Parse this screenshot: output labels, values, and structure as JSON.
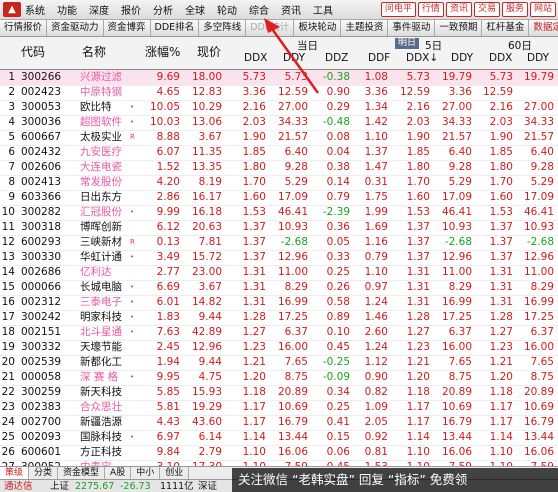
{
  "menu": {
    "items": [
      "系统",
      "功能",
      "深度",
      "报价",
      "分析",
      "全球",
      "轮动",
      "综合",
      "资讯",
      "工具"
    ],
    "right_buttons": [
      "问电平",
      "行情",
      "资讯",
      "交易",
      "服务",
      "网站"
    ]
  },
  "tabs": [
    "行情报价",
    "资金驱动力",
    "资金博弈",
    "DDE排名",
    "多空阵线",
    "DDF统计",
    "板块轮动",
    "主题投资",
    "事件驱动",
    "一致预期",
    "杠杆基金",
    "数据定制"
  ],
  "header": {
    "col_no": "",
    "col_code": "代码",
    "col_name": "名称",
    "col_change": "涨幅%",
    "col_price": "现价",
    "group_today": "当日",
    "group_5d": "5日",
    "group_60d": "60日",
    "tag_today": "明日",
    "sub": [
      "DDX",
      "DDY",
      "DDZ",
      "DDF",
      "DDX↓",
      "DDY",
      "DDX",
      "DDY"
    ]
  },
  "rows": [
    {
      "no": "1",
      "code": "300266",
      "name": "兴源过滤",
      "f": "",
      "chg": "9.69",
      "px": "18.00",
      "v": [
        "5.73",
        "5.73",
        "-0.38",
        "1.08",
        "5.73",
        "19.79",
        "5.73",
        "19.79"
      ]
    },
    {
      "no": "2",
      "code": "002423",
      "name": "中原特钢",
      "f": "",
      "chg": "4.65",
      "px": "12.83",
      "v": [
        "3.36",
        "12.59",
        "0.90",
        "3.36",
        "12.59",
        "3.36",
        "12.59",
        ""
      ]
    },
    {
      "no": "3",
      "code": "300053",
      "name": "欧比特",
      "f": "•",
      "chg": "10.05",
      "px": "10.29",
      "v": [
        "2.16",
        "27.00",
        "0.29",
        "1.34",
        "2.16",
        "27.00",
        "2.16",
        "27.00"
      ]
    },
    {
      "no": "4",
      "code": "300036",
      "name": "超图软件",
      "f": "•",
      "chg": "10.03",
      "px": "13.06",
      "v": [
        "2.03",
        "34.33",
        "-0.48",
        "1.42",
        "2.03",
        "34.33",
        "2.03",
        "34.33"
      ]
    },
    {
      "no": "5",
      "code": "600667",
      "name": "太极实业",
      "f": "R",
      "chg": "8.88",
      "px": "3.67",
      "v": [
        "1.90",
        "21.57",
        "0.08",
        "1.10",
        "1.90",
        "21.57",
        "1.90",
        "21.57"
      ]
    },
    {
      "no": "6",
      "code": "002432",
      "name": "九安医疗",
      "f": "",
      "chg": "6.07",
      "px": "11.35",
      "v": [
        "1.85",
        "6.40",
        "0.04",
        "1.37",
        "1.85",
        "6.40",
        "1.85",
        "6.40"
      ]
    },
    {
      "no": "7",
      "code": "002606",
      "name": "大连电瓷",
      "f": "",
      "chg": "1.52",
      "px": "13.35",
      "v": [
        "1.80",
        "9.28",
        "0.38",
        "1.47",
        "1.80",
        "9.28",
        "1.80",
        "9.28"
      ]
    },
    {
      "no": "8",
      "code": "002413",
      "name": "常发股份",
      "f": "",
      "chg": "4.20",
      "px": "8.19",
      "v": [
        "1.70",
        "5.29",
        "0.14",
        "0.31",
        "1.70",
        "5.29",
        "1.70",
        "5.29"
      ]
    },
    {
      "no": "9",
      "code": "603366",
      "name": "日出东方",
      "f": "",
      "chg": "2.86",
      "px": "16.17",
      "v": [
        "1.60",
        "17.09",
        "0.79",
        "1.75",
        "1.60",
        "17.09",
        "1.60",
        "17.09"
      ]
    },
    {
      "no": "10",
      "code": "300282",
      "name": "汇冠股份",
      "f": "•",
      "chg": "9.99",
      "px": "16.18",
      "v": [
        "1.53",
        "46.41",
        "-2.39",
        "1.99",
        "1.53",
        "46.41",
        "1.53",
        "46.41"
      ]
    },
    {
      "no": "11",
      "code": "300318",
      "name": "博晖创新",
      "f": "",
      "chg": "6.12",
      "px": "20.63",
      "v": [
        "1.37",
        "10.93",
        "0.36",
        "1.69",
        "1.37",
        "10.93",
        "1.37",
        "10.93"
      ]
    },
    {
      "no": "12",
      "code": "600293",
      "name": "三峡新材",
      "f": "R",
      "chg": "0.13",
      "px": "7.81",
      "v": [
        "1.37",
        "-2.68",
        "0.05",
        "1.16",
        "1.37",
        "-2.68",
        "1.37",
        "-2.68"
      ]
    },
    {
      "no": "13",
      "code": "300330",
      "name": "华虹计通",
      "f": "•",
      "chg": "3.49",
      "px": "15.72",
      "v": [
        "1.37",
        "12.96",
        "0.33",
        "0.79",
        "1.37",
        "12.96",
        "1.37",
        "12.96"
      ]
    },
    {
      "no": "14",
      "code": "002686",
      "name": "亿利达",
      "f": "",
      "chg": "2.77",
      "px": "23.00",
      "v": [
        "1.31",
        "11.00",
        "0.25",
        "1.10",
        "1.31",
        "11.00",
        "1.31",
        "11.00"
      ]
    },
    {
      "no": "15",
      "code": "000066",
      "name": "长城电脑",
      "f": "•",
      "chg": "6.69",
      "px": "3.67",
      "v": [
        "1.31",
        "8.29",
        "0.26",
        "0.97",
        "1.31",
        "8.29",
        "1.31",
        "8.29"
      ]
    },
    {
      "no": "16",
      "code": "002312",
      "name": "三泰电子",
      "f": "•",
      "chg": "6.01",
      "px": "14.82",
      "v": [
        "1.31",
        "16.99",
        "0.58",
        "1.24",
        "1.31",
        "16.99",
        "1.31",
        "16.99"
      ]
    },
    {
      "no": "17",
      "code": "300242",
      "name": "明家科技",
      "f": "•",
      "chg": "1.83",
      "px": "9.44",
      "v": [
        "1.28",
        "17.25",
        "0.89",
        "1.46",
        "1.28",
        "17.25",
        "1.28",
        "17.25"
      ]
    },
    {
      "no": "18",
      "code": "002151",
      "name": "北斗星通",
      "f": "•",
      "chg": "7.63",
      "px": "42.89",
      "v": [
        "1.27",
        "6.37",
        "0.10",
        "2.60",
        "1.27",
        "6.37",
        "1.27",
        "6.37"
      ]
    },
    {
      "no": "19",
      "code": "300332",
      "name": "天壕节能",
      "f": "",
      "chg": "2.45",
      "px": "12.96",
      "v": [
        "1.23",
        "16.00",
        "0.45",
        "1.24",
        "1.23",
        "16.00",
        "1.23",
        "16.00"
      ]
    },
    {
      "no": "20",
      "code": "002539",
      "name": "新都化工",
      "f": "",
      "chg": "1.94",
      "px": "9.44",
      "v": [
        "1.21",
        "7.65",
        "-0.25",
        "1.12",
        "1.21",
        "7.65",
        "1.21",
        "7.65"
      ]
    },
    {
      "no": "21",
      "code": "000058",
      "name": "深 赛 格",
      "f": "•",
      "chg": "9.95",
      "px": "4.75",
      "v": [
        "1.20",
        "8.75",
        "-0.09",
        "0.90",
        "1.20",
        "8.75",
        "1.20",
        "8.75"
      ]
    },
    {
      "no": "22",
      "code": "300259",
      "name": "新天科技",
      "f": "",
      "chg": "5.85",
      "px": "15.93",
      "v": [
        "1.18",
        "20.89",
        "0.34",
        "0.82",
        "1.18",
        "20.89",
        "1.18",
        "20.89"
      ]
    },
    {
      "no": "23",
      "code": "002383",
      "name": "合众思壮",
      "f": "",
      "chg": "5.81",
      "px": "19.29",
      "v": [
        "1.17",
        "10.69",
        "0.25",
        "1.09",
        "1.17",
        "10.69",
        "1.17",
        "10.69"
      ]
    },
    {
      "no": "24",
      "code": "002700",
      "name": "新疆浩源",
      "f": "",
      "chg": "4.43",
      "px": "43.60",
      "v": [
        "1.17",
        "16.79",
        "0.41",
        "2.05",
        "1.17",
        "16.79",
        "1.17",
        "16.79"
      ]
    },
    {
      "no": "25",
      "code": "002093",
      "name": "国脉科技",
      "f": "•",
      "chg": "6.97",
      "px": "6.14",
      "v": [
        "1.14",
        "13.44",
        "0.15",
        "0.92",
        "1.14",
        "13.44",
        "1.14",
        "13.44"
      ]
    },
    {
      "no": "26",
      "code": "600601",
      "name": "方正科技",
      "f": "",
      "chg": "9.84",
      "px": "2.79",
      "v": [
        "1.10",
        "16.06",
        "0.06",
        "0.81",
        "1.10",
        "16.06",
        "1.10",
        "16.06"
      ]
    },
    {
      "no": "27",
      "code": "300052",
      "name": "中青宝",
      "f": "",
      "chg": "3.10",
      "px": "17.30",
      "v": [
        "1.10",
        "7.59",
        "0.45",
        "1.53",
        "1.10",
        "7.59",
        "1.10",
        "7.59"
      ]
    }
  ],
  "bottom_tabs": [
    "策级",
    "分类",
    "资金模型",
    "A股",
    "中小",
    "创业"
  ],
  "status": {
    "label": "通达信",
    "index_name": "上证",
    "index_value": "2275.67",
    "index_change": "-26.73",
    "index_amount": "1111亿",
    "index2_name": "深证"
  },
  "watermark": "关注微信 “老韩实盘” 回复 “指标” 免费领"
}
